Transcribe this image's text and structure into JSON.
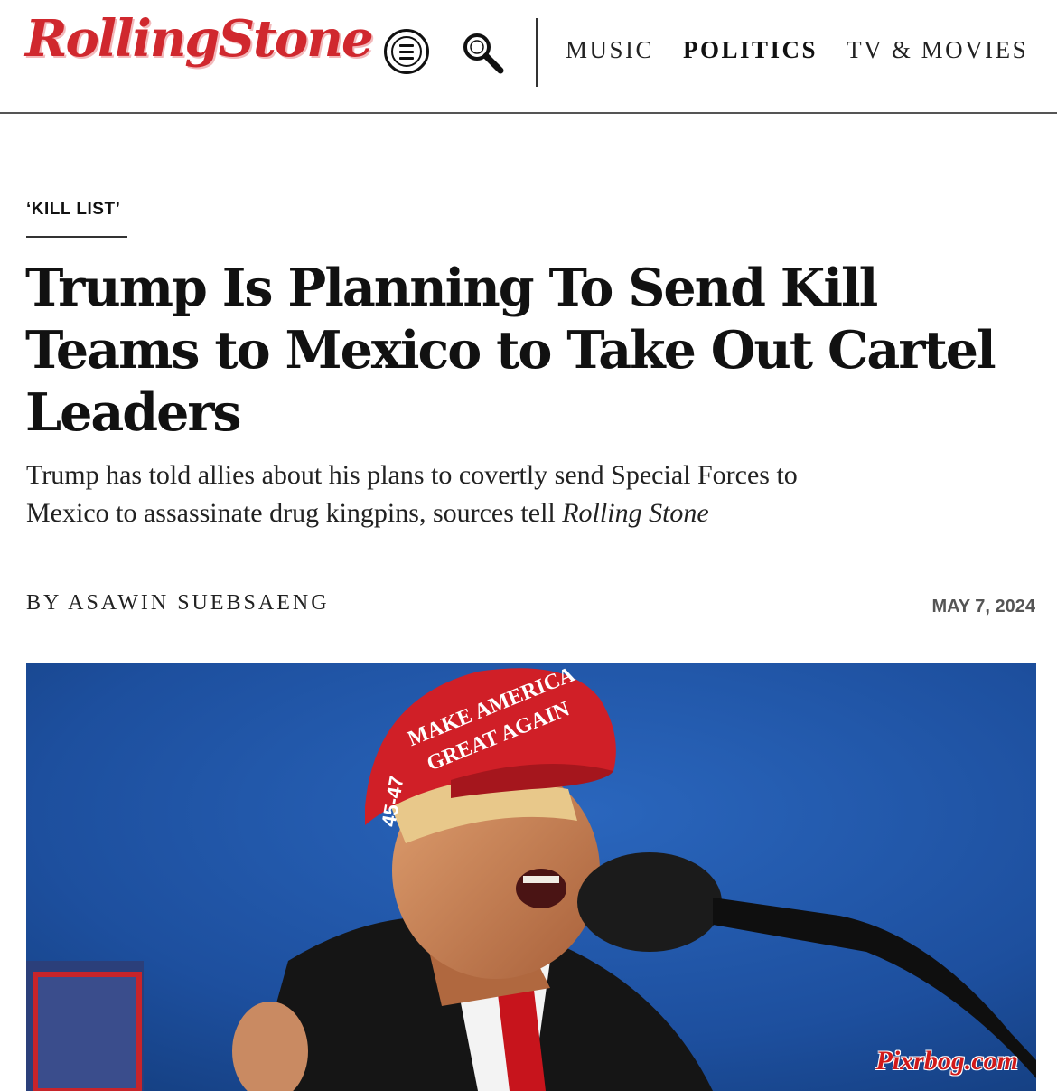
{
  "header": {
    "logo_text": "RollingStone",
    "brand_color": "#d0282e",
    "menu_icon": "menu-icon",
    "search_icon": "search-icon",
    "nav": [
      {
        "label": "MUSIC",
        "active": false
      },
      {
        "label": "POLITICS",
        "active": true
      },
      {
        "label": "TV & MOVIES",
        "active": false
      }
    ]
  },
  "article": {
    "kicker": "‘KILL LIST’",
    "headline": "Trump Is Planning To Send Kill Teams to Mexico to Take Out Cartel Leaders",
    "dek_text": "Trump has told allies about his plans to covertly send Special Forces to Mexico to assassinate drug kingpins, sources tell ",
    "dek_publication": "Rolling Stone",
    "byline": "BY ASAWIN SUEBSAENG",
    "date": "MAY 7, 2024"
  },
  "hero": {
    "cap_line1": "MAKE AMERICA",
    "cap_line2": "GREAT AGAIN",
    "cap_side": "45-47",
    "sky_color": "#1d4f9e",
    "cap_color": "#d01f27"
  },
  "watermark": "Pixrbog.com"
}
